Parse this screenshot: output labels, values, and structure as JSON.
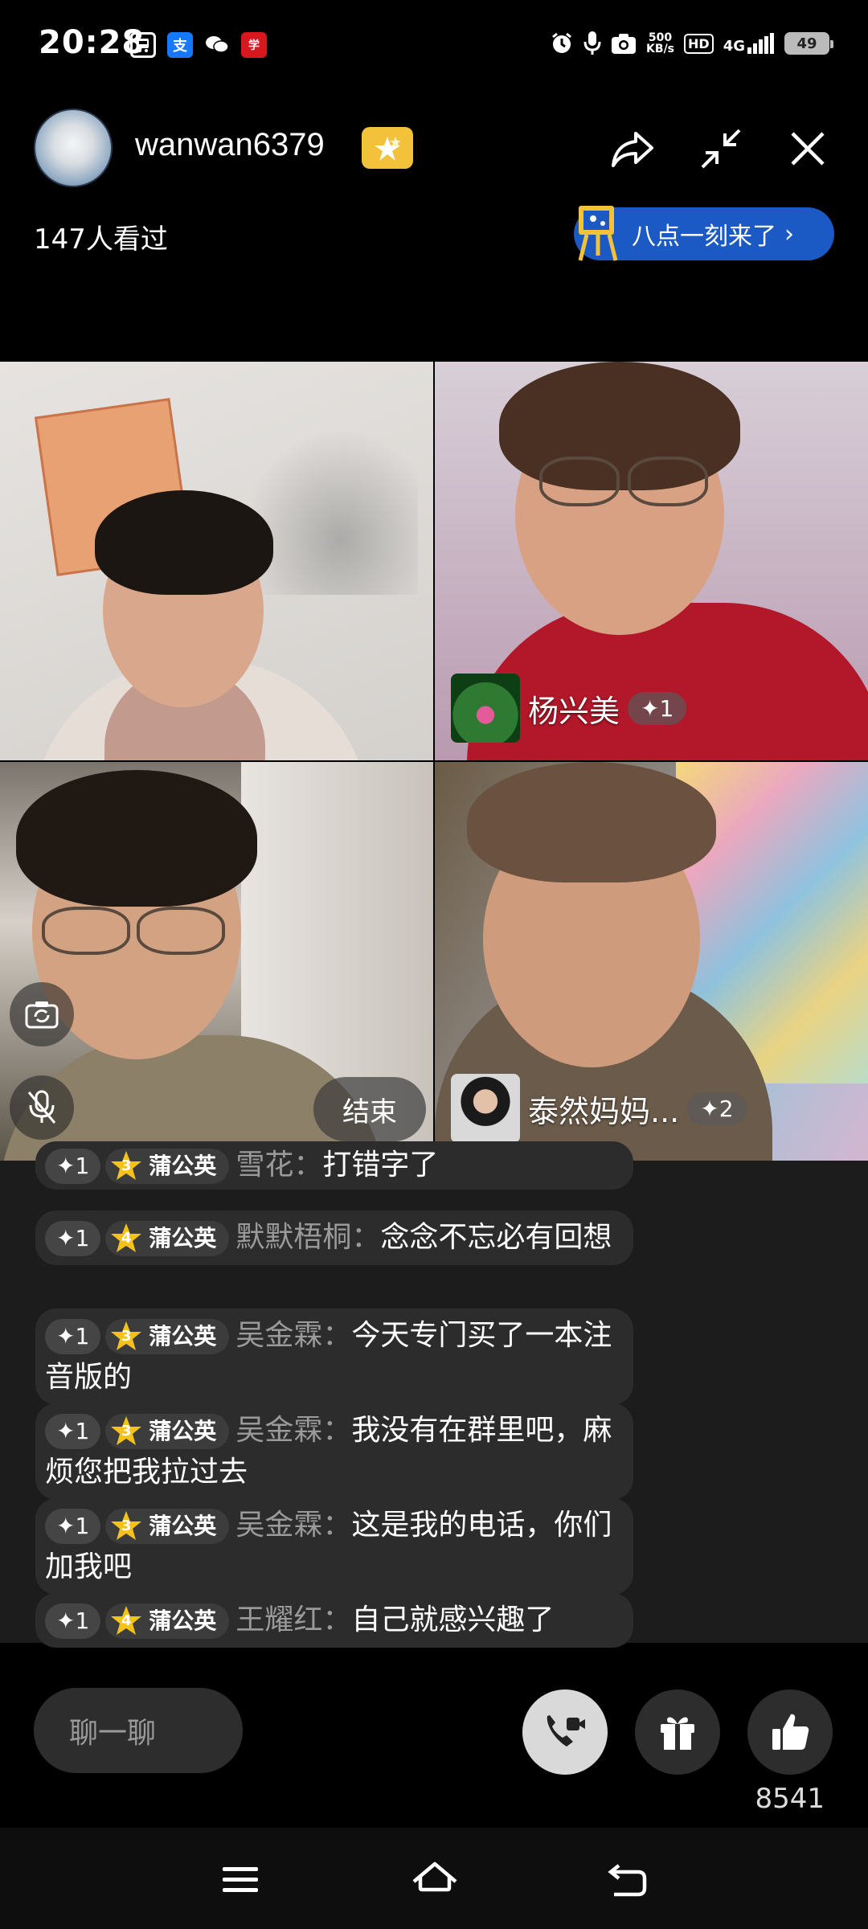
{
  "status_bar": {
    "time": "20:28",
    "speed_value": "500",
    "speed_unit": "KB/s",
    "hd": "HD",
    "network": "4G",
    "battery": "49",
    "app_icons": [
      "transit-icon",
      "alipay-icon",
      "wechat-icon",
      "xuexi-icon"
    ]
  },
  "header": {
    "username": "wanwan6379",
    "viewers": "147人看过",
    "promo_label": "八点一刻来了"
  },
  "tiles": [
    {
      "name": "",
      "badge": ""
    },
    {
      "name": "杨兴美",
      "badge": "1"
    },
    {
      "name": "",
      "badge": ""
    },
    {
      "name": "泰然妈妈...",
      "badge": "2"
    }
  ],
  "controls": {
    "end_label": "结束"
  },
  "chat": [
    {
      "plus": "1",
      "level": "3",
      "medal": "蒲公英",
      "sender": "雪花：",
      "text": "打错字了"
    },
    {
      "plus": "1",
      "level": "4",
      "medal": "蒲公英",
      "sender": "默默梧桐：",
      "text": "念念不忘必有回想"
    },
    {
      "plus": "1",
      "level": "3",
      "medal": "蒲公英",
      "sender": "吴金霖：",
      "text": "今天专门买了一本注音版的"
    },
    {
      "plus": "1",
      "level": "3",
      "medal": "蒲公英",
      "sender": "吴金霖：",
      "text": "我没有在群里吧，麻烦您把我拉过去"
    },
    {
      "plus": "1",
      "level": "3",
      "medal": "蒲公英",
      "sender": "吴金霖：",
      "text": "这是我的电话，你们加我吧"
    },
    {
      "plus": "1",
      "level": "4",
      "medal": "蒲公英",
      "sender": "王耀红：",
      "text": "自己就感兴趣了"
    }
  ],
  "bottom": {
    "chat_placeholder": "聊一聊",
    "like_count": "8541"
  },
  "colors": {
    "background": "#000000",
    "promo_blue": "#1b59c4",
    "badge_gold": "#f3c13a",
    "chat_bubble": "#2c2c2c"
  }
}
